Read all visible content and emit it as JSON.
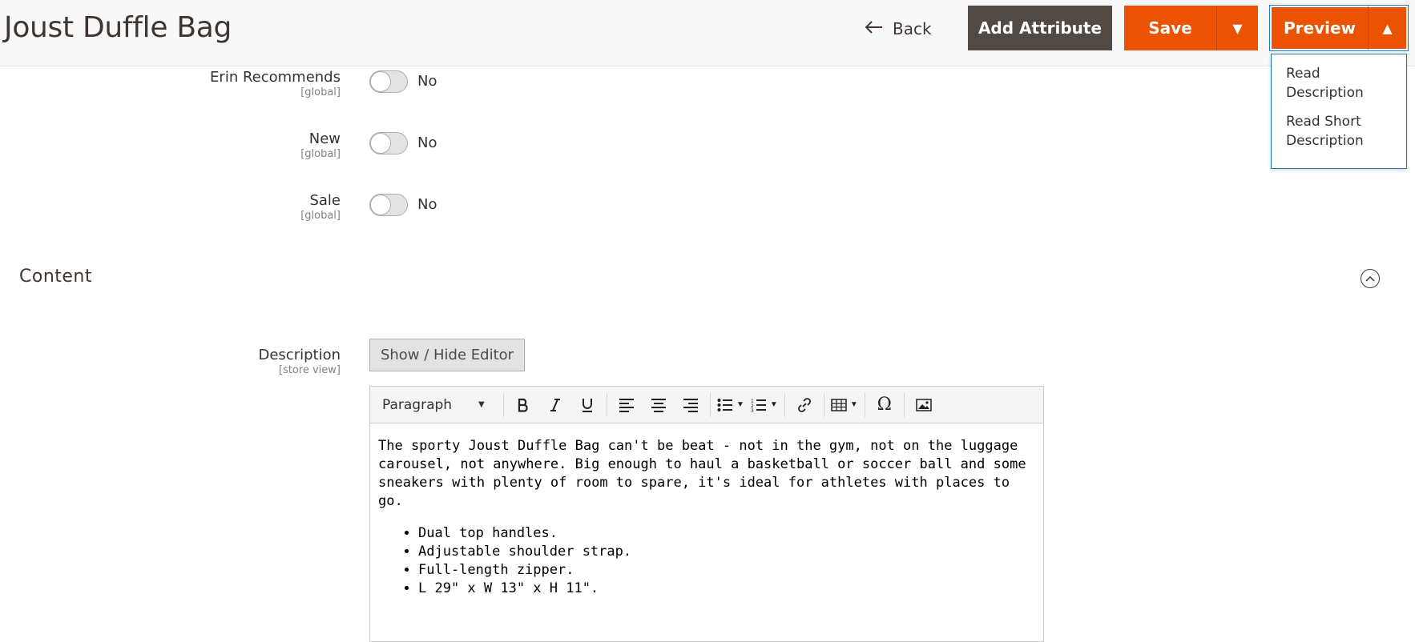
{
  "header": {
    "title": "Joust Duffle Bag",
    "back_label": "Back",
    "add_attribute_label": "Add Attribute",
    "save_label": "Save",
    "preview_label": "Preview",
    "accent_color": "#eb5202"
  },
  "preview_menu": {
    "items": [
      {
        "label_line1": "Read",
        "label_line2": "Description"
      },
      {
        "label_line1": "Read Short",
        "label_line2": "Description"
      }
    ]
  },
  "attributes": [
    {
      "label": "Erin Recommends",
      "scope": "[global]",
      "value": "No"
    },
    {
      "label": "New",
      "scope": "[global]",
      "value": "No"
    },
    {
      "label": "Sale",
      "scope": "[global]",
      "value": "No"
    }
  ],
  "content_section": {
    "title": "Content",
    "description_label": "Description",
    "description_scope": "[store view]",
    "show_hide_label": "Show / Hide Editor",
    "format_select": "Paragraph"
  },
  "editor": {
    "paragraph": "The sporty Joust Duffle Bag can't be beat - not in the gym, not on the luggage carousel, not anywhere. Big enough to haul a basketball or soccer ball and some sneakers with plenty of room to spare, it's ideal for athletes with places to go.",
    "bullets": [
      "Dual top handles.",
      "Adjustable shoulder strap.",
      "Full-length zipper.",
      "L 29\" x W 13\" x H 11\"."
    ]
  }
}
